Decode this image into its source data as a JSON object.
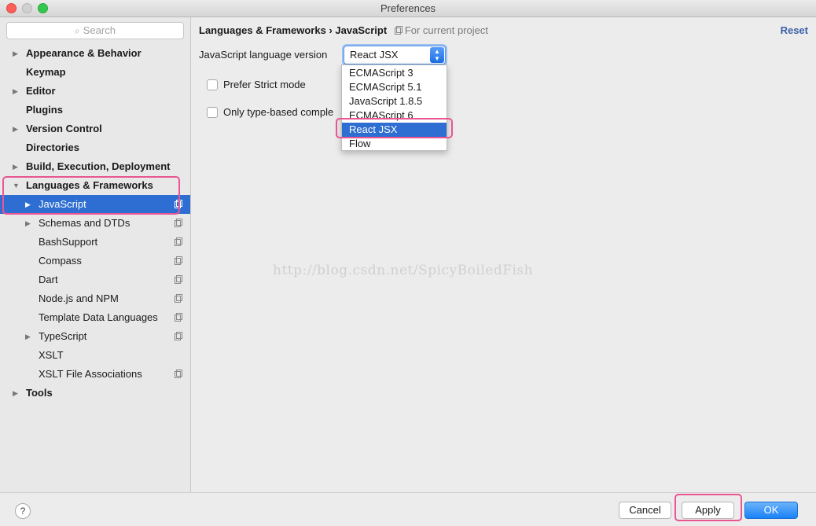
{
  "window": {
    "title": "Preferences"
  },
  "search": {
    "placeholder": "Search"
  },
  "sidebar": {
    "items": [
      {
        "label": "Appearance & Behavior"
      },
      {
        "label": "Keymap"
      },
      {
        "label": "Editor"
      },
      {
        "label": "Plugins"
      },
      {
        "label": "Version Control"
      },
      {
        "label": "Directories"
      },
      {
        "label": "Build, Execution, Deployment"
      },
      {
        "label": "Languages & Frameworks"
      },
      {
        "label": "JavaScript"
      },
      {
        "label": "Schemas and DTDs"
      },
      {
        "label": "BashSupport"
      },
      {
        "label": "Compass"
      },
      {
        "label": "Dart"
      },
      {
        "label": "Node.js and NPM"
      },
      {
        "label": "Template Data Languages"
      },
      {
        "label": "TypeScript"
      },
      {
        "label": "XSLT"
      },
      {
        "label": "XSLT File Associations"
      },
      {
        "label": "Tools"
      }
    ]
  },
  "breadcrumb": {
    "parent": "Languages & Frameworks",
    "separator": "›",
    "current": "JavaScript",
    "scope": "For current project"
  },
  "reset_label": "Reset",
  "lang_version": {
    "label": "JavaScript language version",
    "selected": "React JSX",
    "options": [
      "ECMAScript 3",
      "ECMAScript 5.1",
      "JavaScript 1.8.5",
      "ECMAScript 6",
      "React JSX",
      "Flow"
    ]
  },
  "options": {
    "strict_mode_label": "Prefer Strict mode",
    "type_based_label": "Only type-based comple"
  },
  "watermark": "http://blog.csdn.net/SpicyBoiledFish",
  "footer": {
    "help_label": "?",
    "cancel_label": "Cancel",
    "apply_label": "Apply",
    "ok_label": "OK"
  },
  "colors": {
    "selection": "#2e6dd1",
    "highlight_annotation": "#ea5592",
    "link": "#3b5fa8"
  }
}
